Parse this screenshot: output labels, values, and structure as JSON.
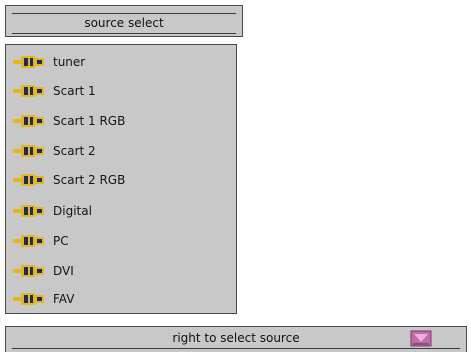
{
  "header": {
    "title": "source select"
  },
  "sources": [
    {
      "label": "tuner",
      "icon": "scart-connector-icon"
    },
    {
      "label": "Scart 1",
      "icon": "scart-connector-icon"
    },
    {
      "label": "Scart 1 RGB",
      "icon": "scart-connector-icon"
    },
    {
      "label": "Scart 2",
      "icon": "scart-connector-icon"
    },
    {
      "label": "Scart 2 RGB",
      "icon": "scart-connector-icon"
    },
    {
      "label": "Digital",
      "icon": "scart-connector-icon"
    },
    {
      "label": "PC",
      "icon": "scart-connector-icon"
    },
    {
      "label": "DVI",
      "icon": "scart-connector-icon"
    },
    {
      "label": "FAV",
      "icon": "scart-connector-icon"
    }
  ],
  "footer": {
    "hint": "right to select source",
    "icon": "menu-icon"
  },
  "colors": {
    "panel": "#c8c8c8",
    "border": "#4a4a4a",
    "icon_yellow": "#e2b81a",
    "icon_navy": "#1e2a68",
    "menu_icon": "#c36aa8"
  }
}
